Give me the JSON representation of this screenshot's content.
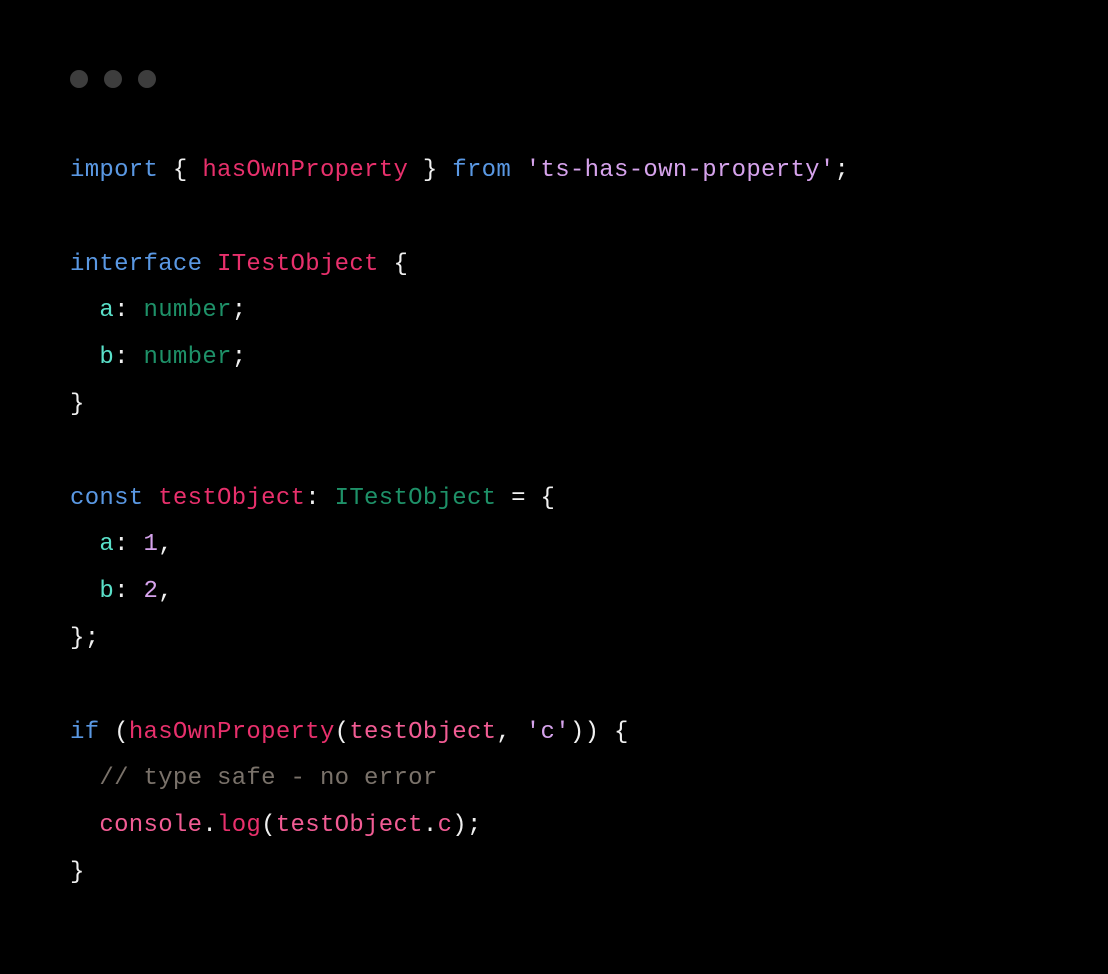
{
  "code": {
    "line1": {
      "import": "import",
      "braceOpen": " { ",
      "fn": "hasOwnProperty",
      "braceClose": " } ",
      "from": "from",
      "space": " ",
      "string": "'ts-has-own-property'",
      "semi": ";"
    },
    "line3": {
      "interface": "interface",
      "space": " ",
      "name": "ITestObject",
      "braceOpen": " {"
    },
    "line4": {
      "indent": "  ",
      "prop": "a",
      "colon": ": ",
      "type": "number",
      "semi": ";"
    },
    "line5": {
      "indent": "  ",
      "prop": "b",
      "colon": ": ",
      "type": "number",
      "semi": ";"
    },
    "line6": {
      "brace": "}"
    },
    "line8": {
      "const": "const",
      "space1": " ",
      "var": "testObject",
      "colon": ": ",
      "type": "ITestObject",
      "equals": " = {"
    },
    "line9": {
      "indent": "  ",
      "prop": "a",
      "colon": ": ",
      "num": "1",
      "comma": ","
    },
    "line10": {
      "indent": "  ",
      "prop": "b",
      "colon": ": ",
      "num": "2",
      "comma": ","
    },
    "line11": {
      "brace": "};"
    },
    "line13": {
      "if": "if",
      "parenOpen": " (",
      "fn": "hasOwnProperty",
      "argOpen": "(",
      "arg1": "testObject",
      "comma": ", ",
      "arg2": "'c'",
      "argClose": ")",
      "parenClose": ") {"
    },
    "line14": {
      "indent": "  ",
      "comment": "// type safe - no error"
    },
    "line15": {
      "indent": "  ",
      "console": "console",
      "dot1": ".",
      "log": "log",
      "parenOpen": "(",
      "obj": "testObject",
      "dot2": ".",
      "prop": "c",
      "parenClose": ");"
    },
    "line16": {
      "brace": "}"
    }
  }
}
